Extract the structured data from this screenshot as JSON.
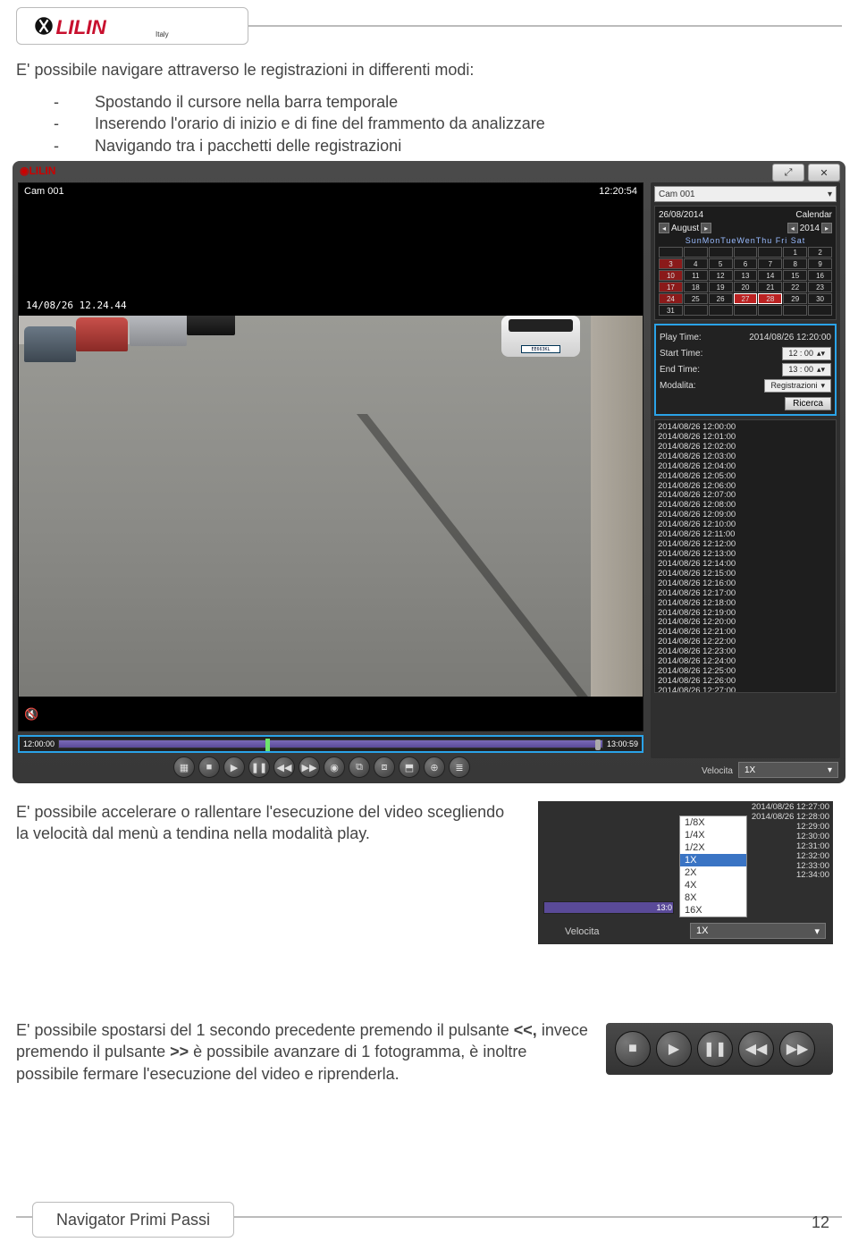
{
  "logo": {
    "brand": "LILIN",
    "italy": "Italy"
  },
  "intro": "E' possibile navigare attraverso le registrazioni in differenti modi:",
  "bullets": [
    "Spostando il cursore nella barra temporale",
    "Inserendo l'orario di inizio e di fine del frammento da analizzare",
    "Navigando tra i pacchetti delle registrazioni"
  ],
  "shot": {
    "cam_label": "Cam 001",
    "cam_time": "12:20:54",
    "video_ts": "14/08/26   12.24.44",
    "plate": "EE663KL",
    "topbtns": [
      "⤢",
      "✕"
    ],
    "cam_select": "Cam 001",
    "calendar": {
      "date": "26/08/2014",
      "label_cal": "Calendar",
      "month": "August",
      "year": "2014",
      "dow": "SunMonTueWenThu Fri  Sat",
      "days": [
        "",
        "",
        "",
        "",
        "",
        "1",
        "2",
        "3",
        "4",
        "5",
        "6",
        "7",
        "8",
        "9",
        "10",
        "11",
        "12",
        "13",
        "14",
        "15",
        "16",
        "17",
        "18",
        "19",
        "20",
        "21",
        "22",
        "23",
        "24",
        "25",
        "26",
        "27",
        "28",
        "29",
        "30",
        "31",
        "",
        "",
        "",
        "",
        "",
        ""
      ],
      "red": [
        7,
        14,
        21,
        28
      ],
      "sel": [
        31,
        32
      ]
    },
    "times": {
      "play_lbl": "Play Time:",
      "play_val": "2014/08/26 12:20:00",
      "start_lbl": "Start Time:",
      "start_val": "12 : 00",
      "end_lbl": "End Time:",
      "end_val": "13 : 00",
      "mode_lbl": "Modalita:",
      "mode_val": "Registrazioni",
      "search": "Ricerca"
    },
    "recordings": [
      "2014/08/26 12:00:00",
      "2014/08/26 12:01:00",
      "2014/08/26 12:02:00",
      "2014/08/26 12:03:00",
      "2014/08/26 12:04:00",
      "2014/08/26 12:05:00",
      "2014/08/26 12:06:00",
      "2014/08/26 12:07:00",
      "2014/08/26 12:08:00",
      "2014/08/26 12:09:00",
      "2014/08/26 12:10:00",
      "2014/08/26 12:11:00",
      "2014/08/26 12:12:00",
      "2014/08/26 12:13:00",
      "2014/08/26 12:14:00",
      "2014/08/26 12:15:00",
      "2014/08/26 12:16:00",
      "2014/08/26 12:17:00",
      "2014/08/26 12:18:00",
      "2014/08/26 12:19:00",
      "2014/08/26 12:20:00",
      "2014/08/26 12:21:00",
      "2014/08/26 12:22:00",
      "2014/08/26 12:23:00",
      "2014/08/26 12:24:00",
      "2014/08/26 12:25:00",
      "2014/08/26 12:26:00",
      "2014/08/26 12:27:00",
      "2014/08/26 12:28:00",
      "2014/08/26 12:29:00",
      "2014/08/26 12:30:00",
      "2014/08/26 12:31:00",
      "2014/08/26 12:32:00",
      "2014/08/26 12:33:00",
      "2014/08/26 12:34:00"
    ],
    "timeline": {
      "start": "12:00:00",
      "end": "13:00:59"
    },
    "controls": [
      "▦",
      "■",
      "▶",
      "❚❚",
      "◀◀",
      "▶▶",
      "◉",
      "⧉",
      "⧈",
      "⬒",
      "⊕",
      "≣"
    ],
    "vel_lbl": "Velocita",
    "vel_val": "1X"
  },
  "para2": "E' possibile accelerare o rallentare l'esecuzione del video scegliendo la velocità dal menù a tendina nella modalità play.",
  "speed_menu": {
    "options": [
      "1/8X",
      "1/4X",
      "1/2X",
      "1X",
      "2X",
      "4X",
      "8X",
      "16X"
    ],
    "selected": "1X",
    "times": [
      "2014/08/26 12:27:00",
      "2014/08/26 12:28:00",
      "12:29:00",
      "12:30:00",
      "12:31:00",
      "12:32:00",
      "12:33:00",
      "12:34:00"
    ],
    "tl_end": "13:0",
    "vel_lbl": "Velocita",
    "vel_val": "1X"
  },
  "para3_a": "E' possibile spostarsi del 1 secondo precedente premendo il pulsante ",
  "para3_b": "<<,",
  "para3_c": " invece premendo il pulsante ",
  "para3_d": ">>",
  "para3_e": " è possibile avanzare di 1 fotogramma, è inoltre possibile fermare l'esecuzione del video e riprenderla.",
  "mini_controls": [
    "■",
    "▶",
    "❚❚",
    "◀◀",
    "▶▶"
  ],
  "footer": {
    "title": "Navigator Primi Passi",
    "page": "12"
  }
}
